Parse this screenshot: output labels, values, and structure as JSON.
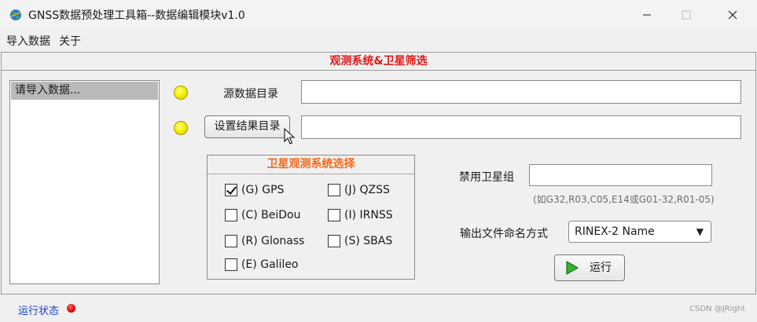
{
  "window": {
    "title": "GNSS数据预处理工具箱--数据编辑模块v1.0"
  },
  "menu": {
    "import_label": "导入数据",
    "about_label": "关于"
  },
  "panel": {
    "title": "观测系统&卫星筛选",
    "title_color": "#e01818"
  },
  "file_list": {
    "items": [
      "请导入数据..."
    ]
  },
  "source": {
    "label": "源数据目录",
    "value": ""
  },
  "output": {
    "button_label": "设置结果目录",
    "value": ""
  },
  "gnss_group": {
    "title": "卫星观测系统选择",
    "title_color": "#f06a1a",
    "options": [
      {
        "label": "(G) GPS",
        "checked": true
      },
      {
        "label": "(J) QZSS",
        "checked": false
      },
      {
        "label": "(C) BeiDou",
        "checked": false
      },
      {
        "label": "(I) IRNSS",
        "checked": false
      },
      {
        "label": "(R) Glonass",
        "checked": false
      },
      {
        "label": "(S) SBAS",
        "checked": false
      },
      {
        "label": "(E) Galileo",
        "checked": false
      }
    ]
  },
  "ban": {
    "label": "禁用卫星组",
    "value": "",
    "hint": "(如G32,R03,C05,E14或G01-32,R01-05)"
  },
  "naming": {
    "label": "输出文件命名方式",
    "selected": "RINEX-2 Name"
  },
  "run": {
    "label": "运行"
  },
  "status": {
    "label": "运行状态",
    "indicator_color": "#e00000"
  },
  "watermark": "CSDN @JRight",
  "icons": {
    "app": "globe-icon",
    "minimize": "minimize-icon",
    "maximize": "maximize-icon",
    "close": "close-icon",
    "run": "play-icon",
    "cursor": "mouse-pointer-icon"
  }
}
